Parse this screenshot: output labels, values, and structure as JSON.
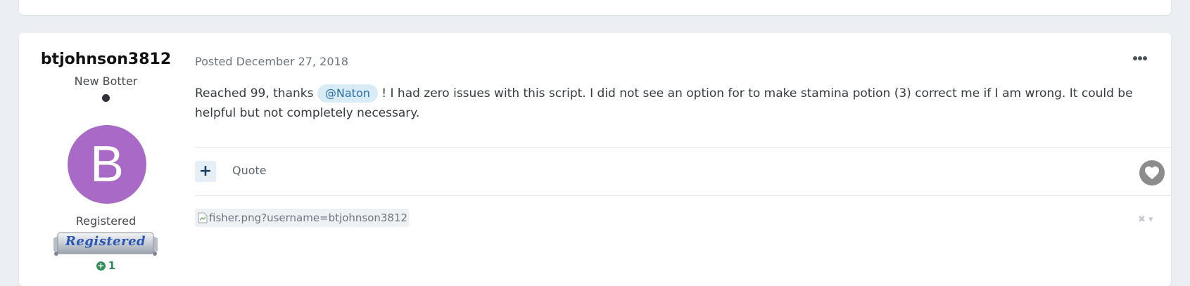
{
  "author": {
    "name": "btjohnson3812",
    "title": "New Botter",
    "avatar_letter": "B",
    "avatar_color": "#a86ac6",
    "group": "Registered",
    "badge_text": "Registered",
    "reputation": "1"
  },
  "post": {
    "meta": "Posted December 27, 2018",
    "body_before": "Reached 99, thanks ",
    "mention": "@Naton",
    "body_after": " ! I had zero issues with this script. I did not see an option for to make stamina potion (3) correct me if I am wrong. It could be helpful but not completely necessary.",
    "quote_label": "Quote",
    "add_symbol": "+"
  },
  "signature": {
    "alt_text": "fisher.png?username=btjohnson3812"
  },
  "colors": {
    "mention_bg": "#d9ebf7",
    "mention_text": "#2a6fa7",
    "reputation": "#2f8f56",
    "page_bg": "#ebeef2"
  }
}
